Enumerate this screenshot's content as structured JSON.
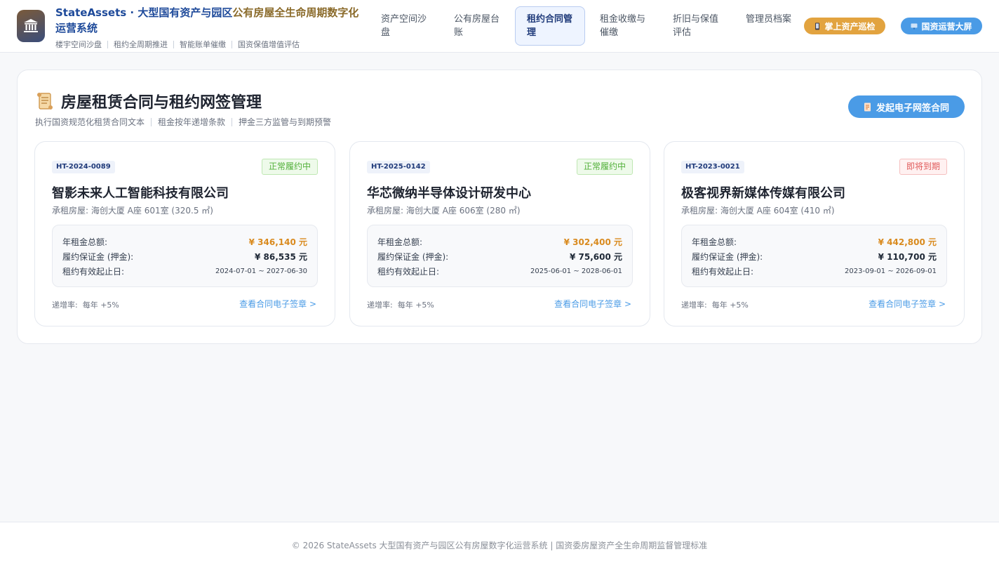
{
  "header": {
    "title_main": "StateAssets · 大型国有资产与园区",
    "title_gold": "公有房屋全生命周期数字化",
    "title_tail": "运营系统",
    "subtitles": [
      "楼宇空间沙盘",
      "租约全周期推进",
      "智能账单催缴",
      "国资保值增值评估"
    ],
    "logo_icon": "bank-building-icon"
  },
  "nav": {
    "items": [
      {
        "label": "资产空间沙盘",
        "active": false
      },
      {
        "label": "公有房屋台账",
        "active": false
      },
      {
        "label": "租约合同管理",
        "active": true
      },
      {
        "label": "租金收缴与催缴",
        "active": false
      },
      {
        "label": "折旧与保值评估",
        "active": false
      },
      {
        "label": "管理员档案",
        "active": false
      }
    ],
    "inspect_button": "掌上资产巡检",
    "screen_button": "国资运营大屏"
  },
  "panel": {
    "title": "房屋租赁合同与租约网签管理",
    "title_icon": "scroll-icon",
    "desc": [
      "执行国资规范化租赁合同文本",
      "租金按年递增条款",
      "押金三方监管与到期预警"
    ],
    "action_button": "发起电子网签合同"
  },
  "labels": {
    "rent_total": "年租金总额:",
    "deposit": "履约保证金 (押金):",
    "period": "租约有效起止日:",
    "rate_prefix": "递增率:",
    "link": "查看合同电子签章 >"
  },
  "contracts": [
    {
      "id": "HT-2024-0089",
      "status": "正常履约中",
      "status_type": "ok",
      "name": "智影未来人工智能科技有限公司",
      "room": "承租房屋:  海创大厦 A座 601室 (320.5 ㎡)",
      "rent": "¥ 346,140 元",
      "deposit": "¥ 86,535 元",
      "period": "2024-07-01 ~ 2027-06-30",
      "rate": "每年 +5%"
    },
    {
      "id": "HT-2025-0142",
      "status": "正常履约中",
      "status_type": "ok",
      "name": "华芯微纳半导体设计研发中心",
      "room": "承租房屋:  海创大厦 A座 606室 (280 ㎡)",
      "rent": "¥ 302,400 元",
      "deposit": "¥ 75,600 元",
      "period": "2025-06-01 ~ 2028-06-01",
      "rate": "每年 +5%"
    },
    {
      "id": "HT-2023-0021",
      "status": "即将到期",
      "status_type": "warn",
      "name": "极客视界新媒体传媒有限公司",
      "room": "承租房屋:  海创大厦 A座 604室 (410 ㎡)",
      "rent": "¥ 442,800 元",
      "deposit": "¥ 110,700 元",
      "period": "2023-09-01 ~ 2026-09-01",
      "rate": "每年 +5%"
    }
  ],
  "footer": {
    "text": "© 2026 StateAssets 大型国有资产与园区公有房屋数字化运营系统 | 国资委房屋资产全生命周期监督管理标准"
  },
  "colors": {
    "accent": "#4a9be6",
    "gold": "#e2a33f",
    "rent": "#d98a1e",
    "ok": "#52b03a",
    "warn": "#e05a5a"
  }
}
